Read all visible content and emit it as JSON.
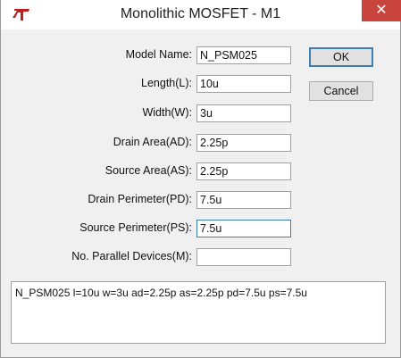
{
  "window": {
    "title": "Monolithic MOSFET - M1",
    "close_glyph": "✕",
    "app_icon": "ltspice-logo-icon",
    "close_color": "#c8443c"
  },
  "fields": [
    {
      "label": "Model Name:",
      "value": "N_PSM025"
    },
    {
      "label": "Length(L):",
      "value": "10u"
    },
    {
      "label": "Width(W):",
      "value": "3u"
    },
    {
      "label": "Drain Area(AD):",
      "value": "2.25p"
    },
    {
      "label": "Source Area(AS):",
      "value": "2.25p"
    },
    {
      "label": "Drain Perimeter(PD):",
      "value": "7.5u"
    },
    {
      "label": "Source Perimeter(PS):",
      "value": "7.5u"
    },
    {
      "label": "No. Parallel Devices(M):",
      "value": ""
    }
  ],
  "buttons": {
    "ok": "OK",
    "cancel": "Cancel"
  },
  "summary": "N_PSM025 l=10u w=3u ad=2.25p as=2.25p pd=7.5u ps=7.5u"
}
